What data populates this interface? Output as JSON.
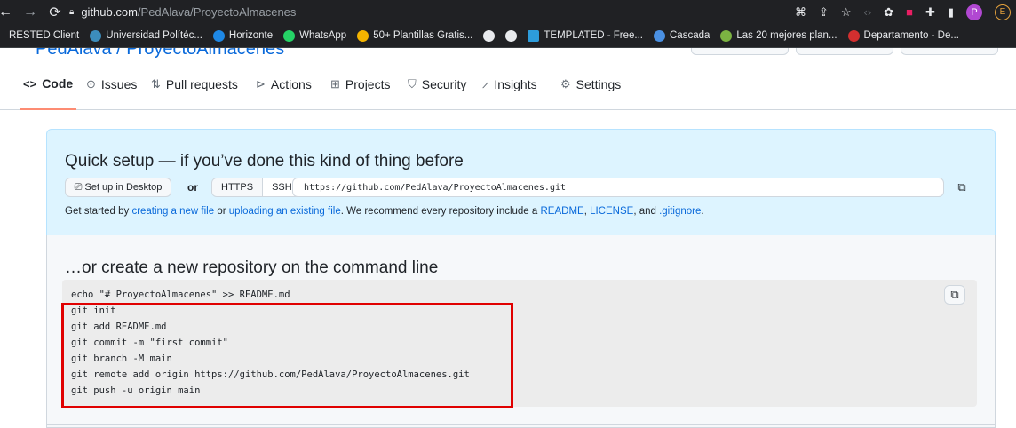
{
  "browser": {
    "url_host": "github.com",
    "url_path": "/PedAlava/ProyectoAlmacenes",
    "avatar_letter": "P",
    "avatar2_letter": "E"
  },
  "bookmarks": [
    {
      "label": "RESTED Client",
      "color": ""
    },
    {
      "label": "Universidad Polítéc...",
      "color": "#3c8dbc"
    },
    {
      "label": "Horizonte",
      "color": "#1e88e5"
    },
    {
      "label": "WhatsApp",
      "color": "#25d366"
    },
    {
      "label": "50+ Plantillas Gratis...",
      "color": "#f4b400"
    },
    {
      "label": "",
      "color": "#e8eaed"
    },
    {
      "label": "",
      "color": "#e8eaed"
    },
    {
      "label": "TEMPLATED - Free...",
      "color": "#2d9cdb"
    },
    {
      "label": "Cascada",
      "color": "#4a90e2"
    },
    {
      "label": "Las 20 mejores plan...",
      "color": "#7cb342"
    },
    {
      "label": "Departamento - De...",
      "color": "#d32f2f"
    }
  ],
  "repo": {
    "title": "PedAlava / ProyectoAlmacenes"
  },
  "tabs": [
    {
      "label": "Code",
      "icon": "code-icon"
    },
    {
      "label": "Issues",
      "icon": "issue-icon"
    },
    {
      "label": "Pull requests",
      "icon": "pull-request-icon"
    },
    {
      "label": "Actions",
      "icon": "play-icon"
    },
    {
      "label": "Projects",
      "icon": "table-icon"
    },
    {
      "label": "Security",
      "icon": "shield-icon"
    },
    {
      "label": "Insights",
      "icon": "graph-icon"
    },
    {
      "label": "Settings",
      "icon": "gear-icon"
    }
  ],
  "quick_setup": {
    "title": "Quick setup — if you’ve done this kind of thing before",
    "desktop_button": "Set up in Desktop",
    "or": "or",
    "https": "HTTPS",
    "ssh": "SSH",
    "clone_url": "https://github.com/PedAlava/ProyectoAlmacenes.git",
    "hint_1": "Get started by ",
    "hint_link_1": "creating a new file",
    "hint_2": " or ",
    "hint_link_2": "uploading an existing file",
    "hint_3": ". We recommend every repository include a ",
    "hint_link_3": "README",
    "hint_4": ", ",
    "hint_link_4": "LICENSE",
    "hint_5": ", and ",
    "hint_link_5": ".gitignore",
    "hint_6": "."
  },
  "command_line": {
    "title": "…or create a new repository on the command line",
    "code": "echo \"# ProyectoAlmacenes\" >> README.md\ngit init\ngit add README.md\ngit commit -m \"first commit\"\ngit branch -M main\ngit remote add origin https://github.com/PedAlava/ProyectoAlmacenes.git\ngit push -u origin main"
  },
  "colors": {
    "highlight": "#e00000",
    "link": "#0969da",
    "setup_bg": "#ddf4ff",
    "active_tab": "#fd8c73"
  }
}
